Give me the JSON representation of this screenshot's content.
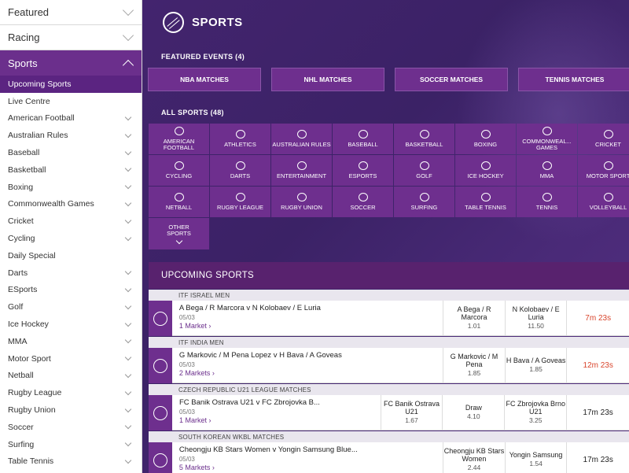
{
  "sidebar": {
    "sections": [
      "Featured",
      "Racing",
      "Sports"
    ],
    "items": [
      {
        "label": "Upcoming Sports",
        "chevron": false
      },
      {
        "label": "Live Centre",
        "chevron": false
      },
      {
        "label": "American Football",
        "chevron": true
      },
      {
        "label": "Australian Rules",
        "chevron": true
      },
      {
        "label": "Baseball",
        "chevron": true
      },
      {
        "label": "Basketball",
        "chevron": true
      },
      {
        "label": "Boxing",
        "chevron": true
      },
      {
        "label": "Commonwealth Games",
        "chevron": true
      },
      {
        "label": "Cricket",
        "chevron": true
      },
      {
        "label": "Cycling",
        "chevron": true
      },
      {
        "label": "Daily Special",
        "chevron": false
      },
      {
        "label": "Darts",
        "chevron": true
      },
      {
        "label": "ESports",
        "chevron": true
      },
      {
        "label": "Golf",
        "chevron": true
      },
      {
        "label": "Ice Hockey",
        "chevron": true
      },
      {
        "label": "MMA",
        "chevron": true
      },
      {
        "label": "Motor Sport",
        "chevron": true
      },
      {
        "label": "Netball",
        "chevron": true
      },
      {
        "label": "Rugby League",
        "chevron": true
      },
      {
        "label": "Rugby Union",
        "chevron": true
      },
      {
        "label": "Soccer",
        "chevron": true
      },
      {
        "label": "Surfing",
        "chevron": true
      },
      {
        "label": "Table Tennis",
        "chevron": true
      }
    ]
  },
  "page": {
    "title": "SPORTS",
    "featured_label": "FEATURED EVENTS (4)",
    "featured": [
      "NBA MATCHES",
      "NHL MATCHES",
      "SOCCER MATCHES",
      "TENNIS MATCHES"
    ],
    "all_label": "ALL SPORTS (48)",
    "sports": [
      "AMERICAN FOOTBALL",
      "ATHLETICS",
      "AUSTRALIAN RULES",
      "BASEBALL",
      "BASKETBALL",
      "BOXING",
      "COMMONWEAL... GAMES",
      "CRICKET",
      "CYCLING",
      "DARTS",
      "ENTERTAINMENT",
      "ESPORTS",
      "GOLF",
      "ICE HOCKEY",
      "MMA",
      "MOTOR SPORT",
      "NETBALL",
      "RUGBY LEAGUE",
      "RUGBY UNION",
      "SOCCER",
      "SURFING",
      "TABLE TENNIS",
      "TENNIS",
      "VOLLEYBALL"
    ],
    "other_sports": "OTHER SPORTS",
    "upcoming_title": "UPCOMING SPORTS"
  },
  "matches": [
    {
      "competition": "ITF ISRAEL MEN",
      "title": "A Bega / R Marcora v N Kolobaev / E Luria",
      "date": "05/03",
      "markets": "1 Market",
      "odds": [
        {
          "name": "A Bega / R Marcora",
          "price": "1.01"
        },
        {
          "name": "N Kolobaev / E Luria",
          "price": "11.50"
        }
      ],
      "time": "7m 23s",
      "time_red": true
    },
    {
      "competition": "ITF INDIA MEN",
      "title": "G Markovic / M Pena Lopez v H Bava / A Goveas",
      "date": "05/03",
      "markets": "2 Markets",
      "odds": [
        {
          "name": "G Markovic / M Pena",
          "price": "1.85"
        },
        {
          "name": "H Bava / A Goveas",
          "price": "1.85"
        }
      ],
      "time": "12m 23s",
      "time_red": true
    },
    {
      "competition": "CZECH REPUBLIC U21 LEAGUE MATCHES",
      "title": "FC Banik Ostrava U21 v FC Zbrojovka B...",
      "date": "05/03",
      "markets": "1 Market",
      "odds": [
        {
          "name": "FC Banik Ostrava U21",
          "price": "1.67"
        },
        {
          "name": "Draw",
          "price": "4.10"
        },
        {
          "name": "FC Zbrojovka Brno U21",
          "price": "3.25"
        }
      ],
      "time": "17m 23s",
      "time_red": false
    },
    {
      "competition": "SOUTH KOREAN WKBL MATCHES",
      "title": "Cheongju KB Stars Women v Yongin Samsung Blue...",
      "date": "05/03",
      "markets": "5 Markets",
      "odds": [
        {
          "name": "Cheongju KB Stars Women",
          "price": "2.44"
        },
        {
          "name": "Yongin Samsung",
          "price": "1.54"
        }
      ],
      "time": "17m 23s",
      "time_red": false
    }
  ]
}
